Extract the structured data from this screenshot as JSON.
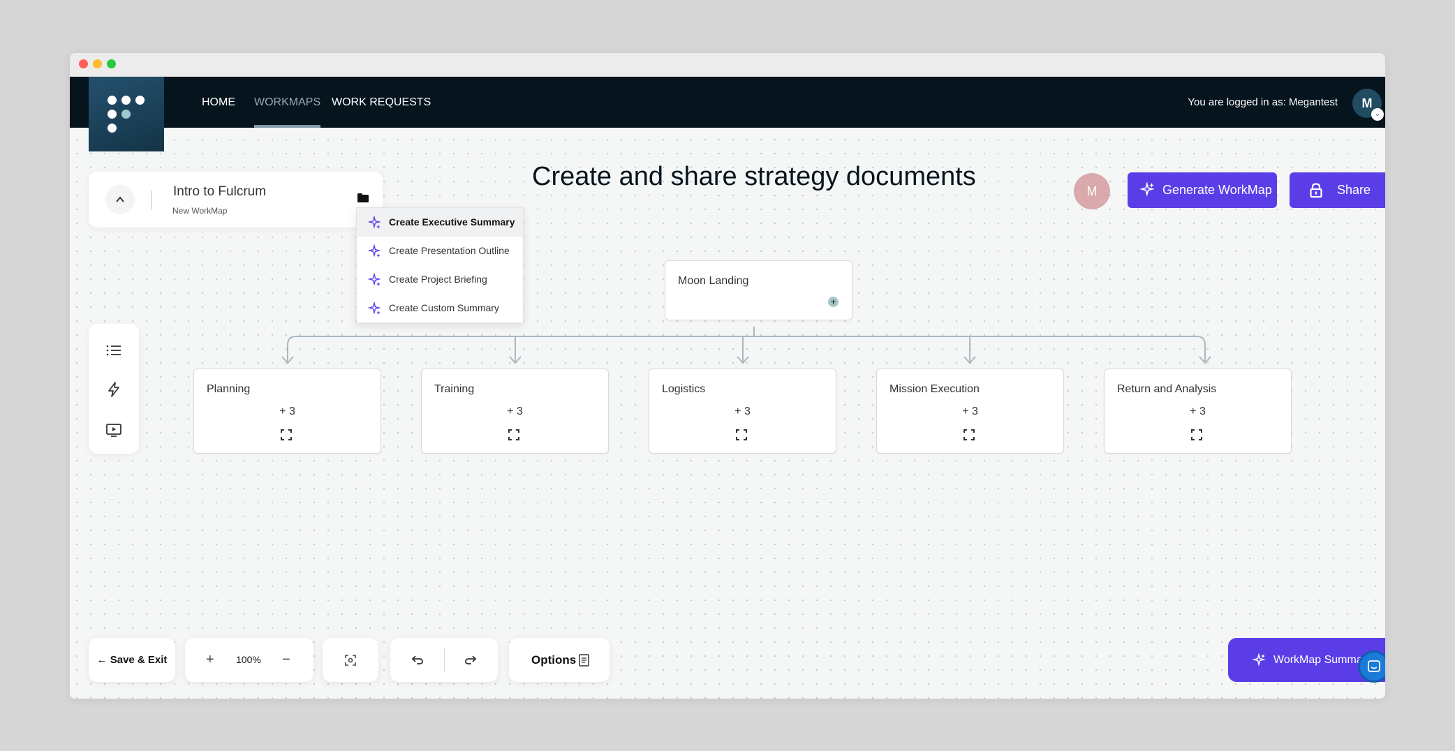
{
  "nav": {
    "links": [
      "HOME",
      "WORKMAPS",
      "WORK REQUESTS"
    ],
    "login_text": "You are logged in as: Megantest",
    "avatar_initial": "M"
  },
  "document": {
    "title": "Intro to Fulcrum",
    "subtitle": "New WorkMap"
  },
  "menu": {
    "items": [
      "Create Executive Summary",
      "Create Presentation Outline",
      "Create Project Briefing",
      "Create Custom Summary"
    ],
    "selected_index": 0
  },
  "page_title": "Create and share strategy documents",
  "header": {
    "user_initial": "M",
    "generate_label": "Generate WorkMap",
    "share_label": "Share"
  },
  "map": {
    "root": {
      "title": "Moon Landing"
    },
    "children": [
      {
        "title": "Planning",
        "count": "+ 3"
      },
      {
        "title": "Training",
        "count": "+ 3"
      },
      {
        "title": "Logistics",
        "count": "+ 3"
      },
      {
        "title": "Mission Execution",
        "count": "+ 3"
      },
      {
        "title": "Return and Analysis",
        "count": "+ 3"
      }
    ]
  },
  "toolbar": {
    "save_exit": "Save & Exit",
    "zoom_level": "100%",
    "options": "Options"
  },
  "summary_button": "WorkMap Summa",
  "colors": {
    "nav_bg": "#06141d",
    "accent": "#5b3de8",
    "user_avatar": "#d9a9ab"
  },
  "icons": {
    "sparkle": "sparkle-icon",
    "folder": "folder-icon",
    "lock": "lock-icon",
    "list": "list-icon",
    "bolt": "bolt-icon",
    "play": "play-icon",
    "expand": "expand-icon",
    "undo": "undo-icon",
    "redo": "redo-icon",
    "document": "document-icon",
    "chat": "chat-icon"
  }
}
